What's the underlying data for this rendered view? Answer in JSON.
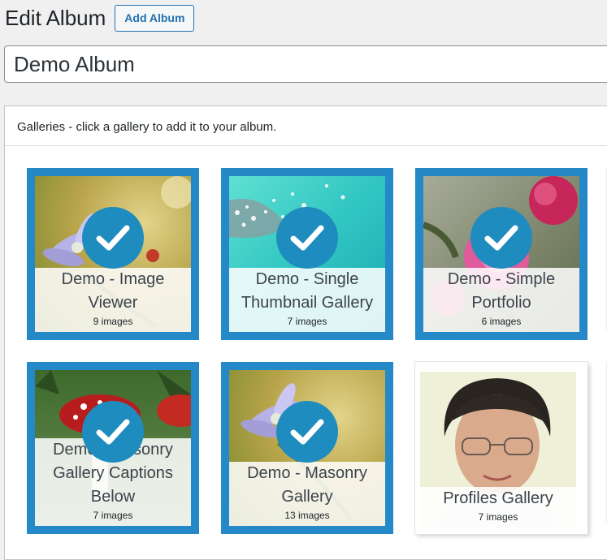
{
  "header": {
    "title": "Edit Album",
    "add_button": "Add Album"
  },
  "album_name": {
    "value": "Demo Album"
  },
  "panel": {
    "heading": "Galleries - click a gallery to add it to your album."
  },
  "galleries": [
    {
      "title": "Demo - Image Viewer",
      "count": "9 images",
      "selected": true,
      "thumb": "purple-flower"
    },
    {
      "title": "Demo - Single Thumbnail Gallery",
      "count": "7 images",
      "selected": true,
      "thumb": "water-drops"
    },
    {
      "title": "Demo - Simple Portfolio",
      "count": "6 images",
      "selected": true,
      "thumb": "pink-roses"
    },
    {
      "title": "Demo - Masonry Gallery Captions Below",
      "count": "7 images",
      "selected": true,
      "thumb": "red-mushroom"
    },
    {
      "title": "Demo - Masonry Gallery",
      "count": "13 images",
      "selected": true,
      "thumb": "purple-flower"
    },
    {
      "title": "Profiles Gallery",
      "count": "7 images",
      "selected": false,
      "thumb": "portrait"
    }
  ],
  "colors": {
    "selected_border": "#2589c8",
    "check_badge": "#1e8cbe",
    "button_accent": "#2271b1"
  }
}
